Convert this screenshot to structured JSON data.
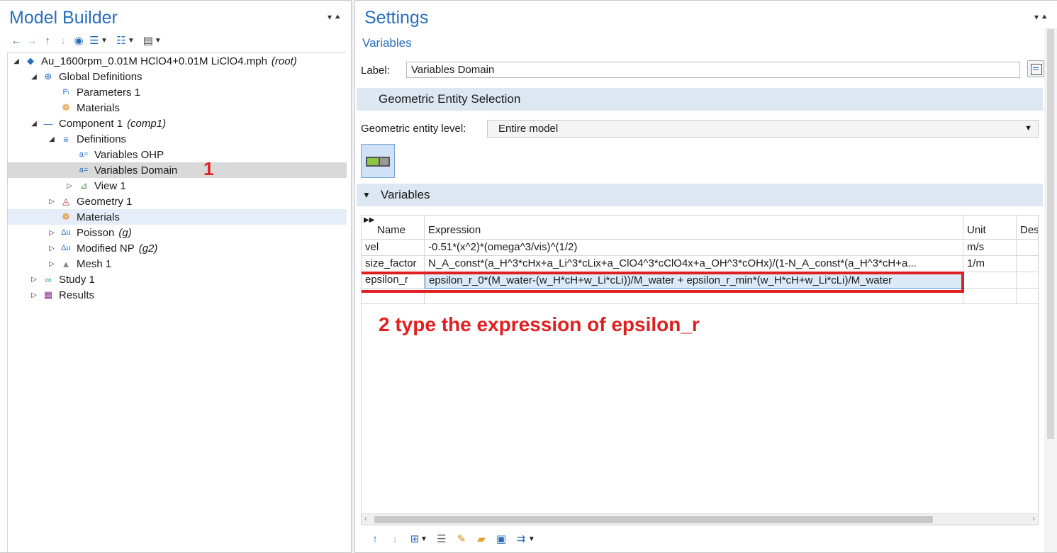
{
  "left_panel": {
    "title": "Model Builder",
    "tree": [
      {
        "name": "tree-root",
        "label": "Au_1600rpm_0.01M HClO4+0.01M LiClO4.mph",
        "suffix": "(root)",
        "icon": "model-icon",
        "expanded": true
      },
      {
        "name": "tree-global-definitions",
        "label": "Global Definitions",
        "suffix": "",
        "icon": "globe-icon",
        "expanded": true
      },
      {
        "name": "tree-parameters-1",
        "label": "Parameters 1",
        "suffix": "",
        "icon": "parameters-icon"
      },
      {
        "name": "tree-global-materials",
        "label": "Materials",
        "suffix": "",
        "icon": "materials-icon"
      },
      {
        "name": "tree-component-1",
        "label": "Component 1",
        "suffix": "(comp1)",
        "icon": "component-icon",
        "expanded": true
      },
      {
        "name": "tree-definitions",
        "label": "Definitions",
        "suffix": "",
        "icon": "definitions-icon",
        "expanded": true
      },
      {
        "name": "tree-variables-ohp",
        "label": "Variables OHP",
        "suffix": "",
        "icon": "variables-icon"
      },
      {
        "name": "tree-variables-domain",
        "label": "Variables Domain",
        "suffix": "",
        "icon": "variables-icon",
        "selected": true
      },
      {
        "name": "tree-view-1",
        "label": "View 1",
        "suffix": "",
        "icon": "view-icon",
        "collapsed": true
      },
      {
        "name": "tree-geometry-1",
        "label": "Geometry 1",
        "suffix": "",
        "icon": "geometry-icon",
        "collapsed": true
      },
      {
        "name": "tree-materials",
        "label": "Materials",
        "suffix": "",
        "icon": "materials-icon"
      },
      {
        "name": "tree-poisson",
        "label": "Poisson",
        "suffix": "(g)",
        "icon": "physics-icon",
        "collapsed": true
      },
      {
        "name": "tree-modified-np",
        "label": "Modified NP",
        "suffix": "(g2)",
        "icon": "physics-icon",
        "collapsed": true
      },
      {
        "name": "tree-mesh-1",
        "label": "Mesh 1",
        "suffix": "",
        "icon": "mesh-icon",
        "collapsed": true
      },
      {
        "name": "tree-study-1",
        "label": "Study 1",
        "suffix": "",
        "icon": "study-icon",
        "collapsed": true
      },
      {
        "name": "tree-results",
        "label": "Results",
        "suffix": "",
        "icon": "results-icon",
        "collapsed": true
      }
    ],
    "annotation_1": "1"
  },
  "right_panel": {
    "title": "Settings",
    "subtitle": "Variables",
    "label_caption": "Label:",
    "label_value": "Variables Domain",
    "geo_section_title": "Geometric Entity Selection",
    "geo_level_caption": "Geometric entity level:",
    "geo_level_value": "Entire model",
    "variables_section_title": "Variables",
    "table": {
      "headers": [
        "Name",
        "Expression",
        "Unit",
        "Des"
      ],
      "rows": [
        {
          "name": "vel",
          "expression": "-0.51*(x^2)*(omega^3/vis)^(1/2)",
          "unit": "m/s"
        },
        {
          "name": "size_factor",
          "expression": "N_A_const*(a_H^3*cHx+a_Li^3*cLix+a_ClO4^3*cClO4x+a_OH^3*cOHx)/(1-N_A_const*(a_H^3*cH+a...",
          "unit": "1/m"
        },
        {
          "name": "epsilon_r",
          "expression": "epsilon_r_0*(M_water-(w_H*cH+w_Li*cLi))/M_water + epsilon_r_min*(w_H*cH+w_Li*cLi)/M_water",
          "unit": ""
        }
      ]
    },
    "annotation_2": "2 type the expression of epsilon_r",
    "accent_color": "#2a6ebb",
    "annotation_color": "#e02020"
  }
}
